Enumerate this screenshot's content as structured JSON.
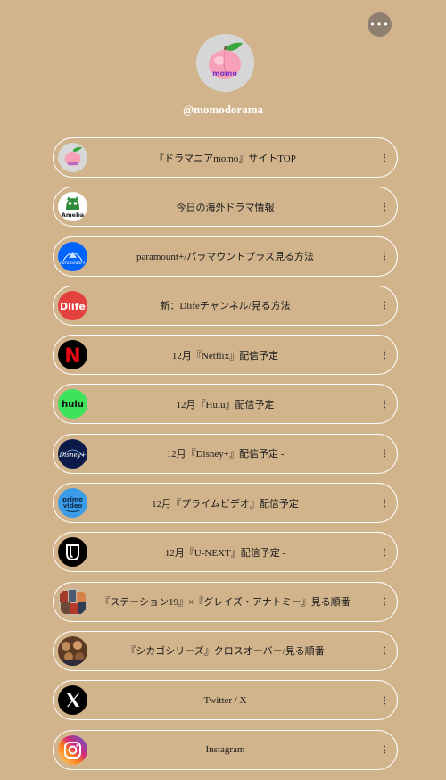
{
  "profile": {
    "handle": "@momodorama",
    "avatar_text": "momo",
    "avatar_icon": "peach-logo"
  },
  "header": {
    "more_icon": "ellipsis-icon",
    "more_label": "•••"
  },
  "colors": {
    "background": "#d2b48c",
    "link_border": "#ffffff",
    "more_button": "#8f7f70"
  },
  "links": [
    {
      "label": "『ドラマニアmomo』サイトTOP",
      "icon": "peach-logo-icon"
    },
    {
      "label": "今日の海外ドラマ情報",
      "icon": "ameba-icon",
      "icon_text": "Ameba"
    },
    {
      "label": "paramount+/パラマウントプラス見る方法",
      "icon": "paramount-plus-icon",
      "icon_text": "Paramount+"
    },
    {
      "label": "新：Dlifeチャンネル/見る方法",
      "icon": "dlife-icon",
      "icon_text": "Dlife"
    },
    {
      "label": "12月『Netflix』配信予定",
      "icon": "netflix-icon",
      "icon_text": "N"
    },
    {
      "label": "12月『Hulu』配信予定",
      "icon": "hulu-icon",
      "icon_text": "hulu"
    },
    {
      "label": "12月『Disney+』配信予定 -",
      "icon": "disney-plus-icon",
      "icon_text": "Disney+"
    },
    {
      "label": "12月『プライムビデオ』配信予定",
      "icon": "prime-video-icon",
      "icon_text": "prime video"
    },
    {
      "label": "12月『U-NEXT』配信予定 -",
      "icon": "u-next-icon",
      "icon_text": "U"
    },
    {
      "label": "『ステーション19』×『グレイズ・アナトミー』見る順番",
      "icon": "station19-thumbnail-icon"
    },
    {
      "label": "『シカゴシリーズ』クロスオーバー/見る順番",
      "icon": "chicago-series-thumbnail-icon"
    },
    {
      "label": "Twitter / X",
      "icon": "x-logo-icon",
      "icon_text": "X"
    },
    {
      "label": "Instagram",
      "icon": "instagram-icon"
    }
  ]
}
